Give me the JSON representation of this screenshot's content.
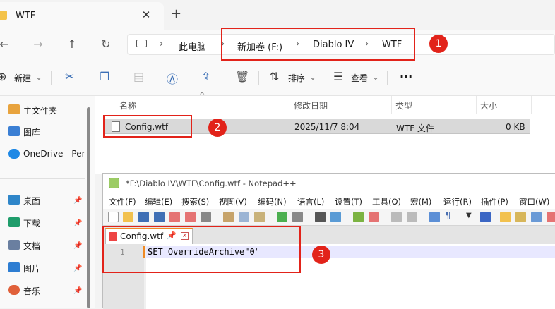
{
  "explorer": {
    "tab_title": "WTF",
    "tab_close": "✕",
    "new_tab": "+",
    "breadcrumb": [
      "此电脑",
      "新加卷 (F:)",
      "Diablo IV",
      "WTF"
    ],
    "commands": {
      "new": "新建",
      "sort": "排序",
      "view": "查看",
      "more": "···"
    },
    "sidebar": [
      {
        "label": "主文件夹",
        "icon": "home-icon",
        "pinned": false
      },
      {
        "label": "图库",
        "icon": "gallery-icon",
        "pinned": false
      },
      {
        "label": "OneDrive - Per",
        "icon": "cloud-icon",
        "pinned": false
      },
      {
        "label": "桌面",
        "icon": "desktop-icon",
        "pinned": true
      },
      {
        "label": "下载",
        "icon": "download-icon",
        "pinned": true
      },
      {
        "label": "文档",
        "icon": "document-icon",
        "pinned": true
      },
      {
        "label": "图片",
        "icon": "picture-icon",
        "pinned": true
      },
      {
        "label": "音乐",
        "icon": "music-icon",
        "pinned": true
      }
    ],
    "columns": [
      "名称",
      "修改日期",
      "类型",
      "大小"
    ],
    "files": [
      {
        "name": "Config.wtf",
        "modified": "2025/11/7 8:04",
        "type": "WTF 文件",
        "size": "0 KB"
      }
    ]
  },
  "notepad": {
    "title": "*F:\\Diablo IV\\WTF\\Config.wtf - Notepad++",
    "menu": [
      "文件(F)",
      "编辑(E)",
      "搜索(S)",
      "视图(V)",
      "编码(N)",
      "语言(L)",
      "设置(T)",
      "工具(O)",
      "宏(M)",
      "运行(R)",
      "插件(P)",
      "窗口(W)"
    ],
    "tab_name": "Config.wtf",
    "tab_pin": "📌",
    "tab_close": "x",
    "line_number": "1",
    "code": "SET OverrideArchive\"0\""
  },
  "annotations": [
    "1",
    "2",
    "3"
  ],
  "colors": {
    "callout": "#e2231a",
    "accent": "#3b6fb6",
    "notepad_tab_accent": "#f08a24"
  }
}
